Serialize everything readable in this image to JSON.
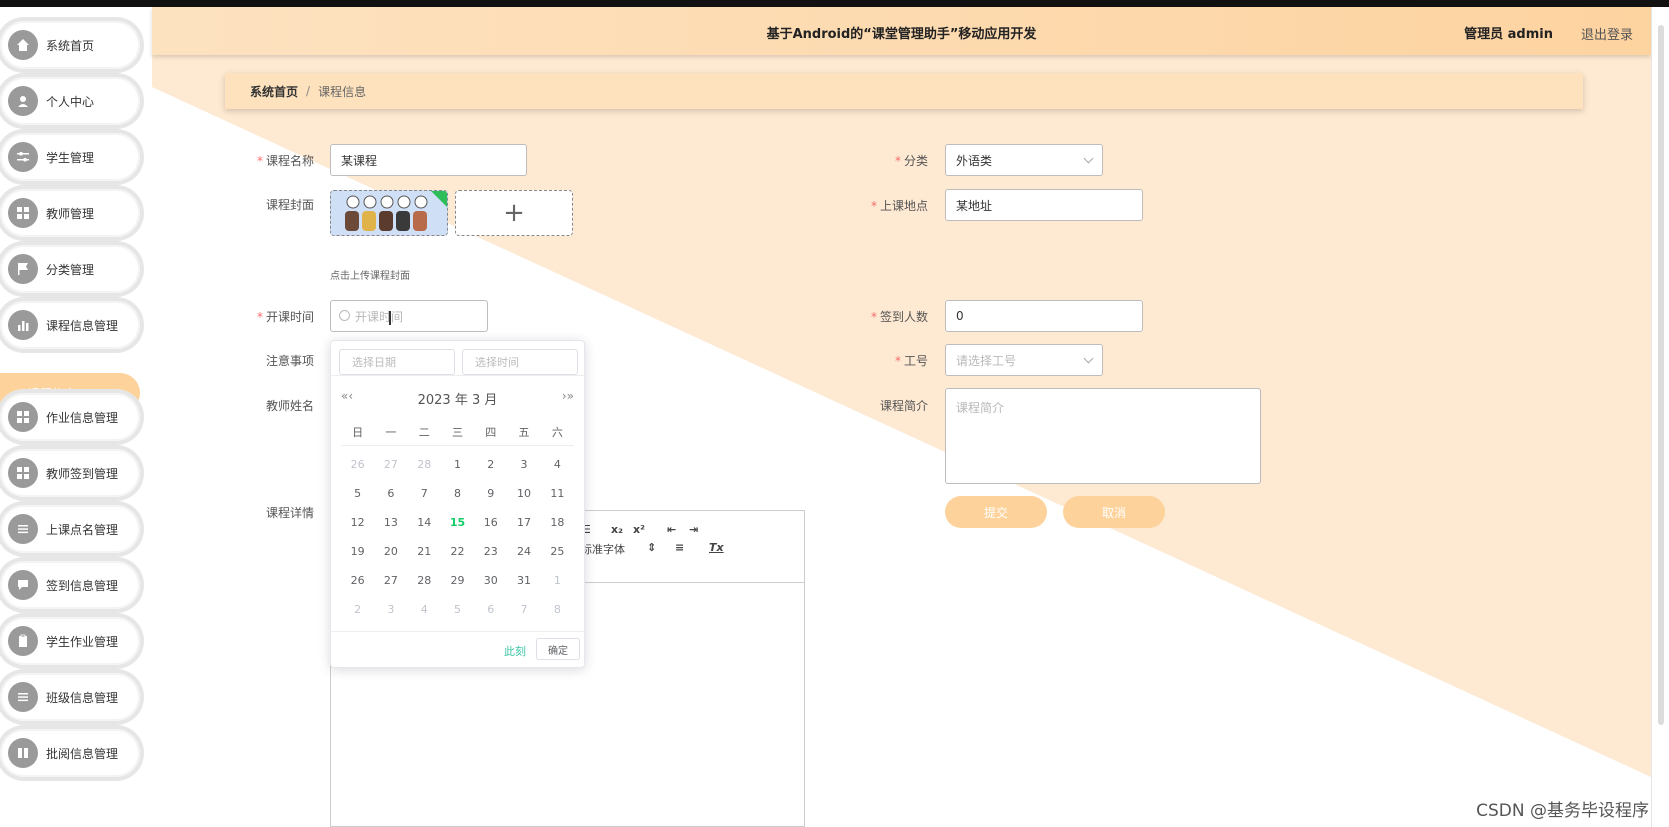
{
  "header": {
    "title": "基于Android的“课堂管理助手”移动应用开发",
    "user": "管理员 admin",
    "logout": "退出登录"
  },
  "sidebar": {
    "items": [
      {
        "label": "系统首页"
      },
      {
        "label": "个人中心"
      },
      {
        "label": "学生管理"
      },
      {
        "label": "教师管理"
      },
      {
        "label": "分类管理"
      },
      {
        "label": "课程信息管理"
      },
      {
        "label": "作业信息管理"
      },
      {
        "label": "教师签到管理"
      },
      {
        "label": "上课点名管理"
      },
      {
        "label": "签到信息管理"
      },
      {
        "label": "学生作业管理"
      },
      {
        "label": "班级信息管理"
      },
      {
        "label": "批阅信息管理"
      }
    ],
    "active_sub": "课程信息"
  },
  "breadcrumb": {
    "home": "系统首页",
    "sep": "/",
    "current": "课程信息"
  },
  "form": {
    "course_name_label": "课程名称",
    "course_name_value": "某课程",
    "cover_label": "课程封面",
    "cover_plus": "+",
    "cover_hint": "点击上传课程封面",
    "start_time_label": "开课时间",
    "start_time_placeholder": "开课时间",
    "notes_label": "注意事项",
    "teacher_name_label": "教师姓名",
    "detail_label": "课程详情",
    "category_label": "分类",
    "category_value": "外语类",
    "location_label": "上课地点",
    "location_value": "某地址",
    "checkin_count_label": "签到人数",
    "checkin_count_value": "0",
    "job_no_label": "工号",
    "job_no_placeholder": "请选择工号",
    "intro_label": "课程简介",
    "intro_placeholder": "课程简介",
    "submit_label": "提交",
    "cancel_label": "取消",
    "required_mark": "*"
  },
  "editor": {
    "toolbar": {
      "align": "☰",
      "sub": "x₂",
      "sup": "x²",
      "outdent": "⇤",
      "indent": "⇥",
      "font": "标准字体",
      "font_arrow": "⇕",
      "align2": "≡",
      "clear": "Tx"
    }
  },
  "datepicker": {
    "date_placeholder": "选择日期",
    "time_placeholder": "选择时间",
    "prev": "«‹",
    "next": "›»",
    "year_month": "2023 年  3 月",
    "weekdays": [
      "日",
      "一",
      "二",
      "三",
      "四",
      "五",
      "六"
    ],
    "weeks": [
      [
        "26",
        "27",
        "28",
        "1",
        "2",
        "3",
        "4"
      ],
      [
        "5",
        "6",
        "7",
        "8",
        "9",
        "10",
        "11"
      ],
      [
        "12",
        "13",
        "14",
        "15",
        "16",
        "17",
        "18"
      ],
      [
        "19",
        "20",
        "21",
        "22",
        "23",
        "24",
        "25"
      ],
      [
        "26",
        "27",
        "28",
        "29",
        "30",
        "31",
        "1"
      ],
      [
        "2",
        "3",
        "4",
        "5",
        "6",
        "7",
        "8"
      ]
    ],
    "today": "15",
    "now_label": "此刻",
    "ok_label": "确定"
  },
  "watermark": "CSDN @基务毕设程序",
  "colors": {
    "accent": "#fdd39b",
    "header": "#fdd3a0",
    "today": "#13ce66"
  }
}
